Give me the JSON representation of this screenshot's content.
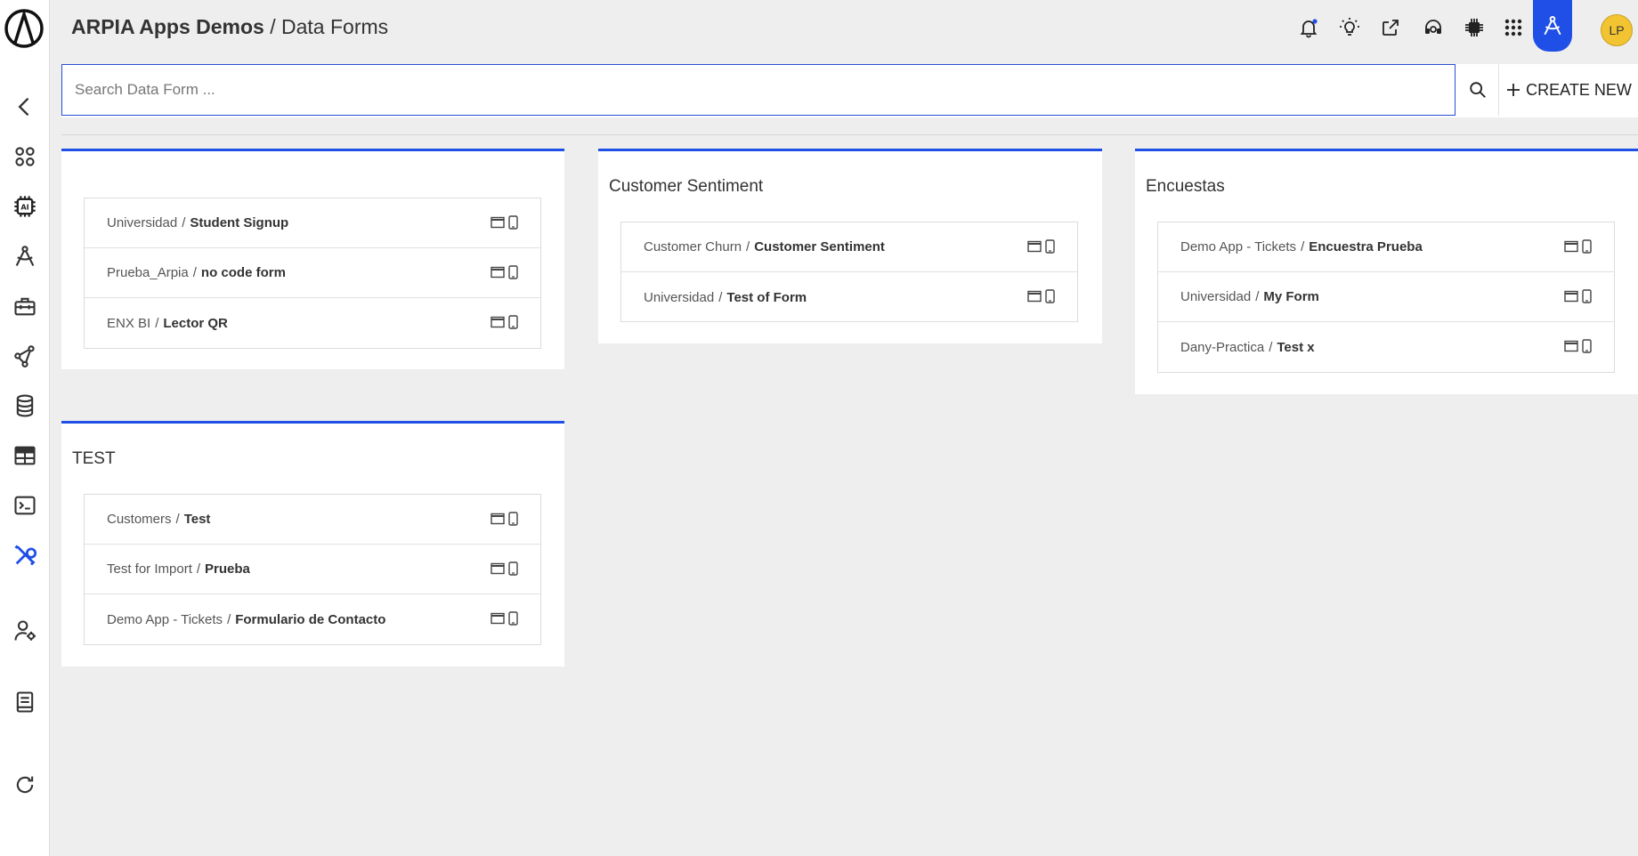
{
  "header": {
    "app_name": "ARPIA Apps Demos",
    "separator": "/",
    "page_name": "Data Forms",
    "avatar_initials": "LP"
  },
  "search": {
    "placeholder": "Search Data Form ...",
    "value": ""
  },
  "toolbar": {
    "create_label": "CREATE NEW"
  },
  "colors": {
    "accent": "#1f4fe6",
    "avatar": "#f3c431",
    "notification_dot": "#1f4fe6"
  },
  "sidebar": {
    "items": [
      {
        "icon": "chevron-left-icon"
      },
      {
        "icon": "apps-circles-icon"
      },
      {
        "icon": "ai-chip-icon"
      },
      {
        "icon": "compass-icon"
      },
      {
        "icon": "toolbox-icon"
      },
      {
        "icon": "network-icon"
      },
      {
        "icon": "database-icon"
      },
      {
        "icon": "table-icon"
      },
      {
        "icon": "terminal-icon"
      },
      {
        "icon": "tools-icon",
        "active": true
      },
      {
        "icon": "user-settings-icon"
      },
      {
        "icon": "notebook-icon"
      },
      {
        "icon": "refresh-icon"
      }
    ]
  },
  "top_icons": [
    "bell-icon",
    "lightbulb-icon",
    "share-icon",
    "headset-icon",
    "chip-icon",
    "grid-icon",
    "compass-icon"
  ],
  "groups": [
    {
      "title": "",
      "forms": [
        {
          "app": "Universidad",
          "name": "Student Signup"
        },
        {
          "app": "Prueba_Arpia",
          "name": "no code form"
        },
        {
          "app": "ENX BI",
          "name": "Lector QR"
        }
      ]
    },
    {
      "title": "Customer Sentiment",
      "forms": [
        {
          "app": "Customer Churn",
          "name": "Customer Sentiment"
        },
        {
          "app": "Universidad",
          "name": "Test of Form"
        }
      ]
    },
    {
      "title": "Encuestas",
      "forms": [
        {
          "app": "Demo App - Tickets",
          "name": "Encuestra Prueba"
        },
        {
          "app": "Universidad",
          "name": "My Form"
        },
        {
          "app": "Dany-Practica",
          "name": "Test x"
        }
      ]
    },
    {
      "title": "TEST",
      "forms": [
        {
          "app": "Customers",
          "name": "Test"
        },
        {
          "app": "Test for Import",
          "name": "Prueba"
        },
        {
          "app": "Demo App - Tickets",
          "name": "Formulario de Contacto"
        }
      ]
    }
  ]
}
